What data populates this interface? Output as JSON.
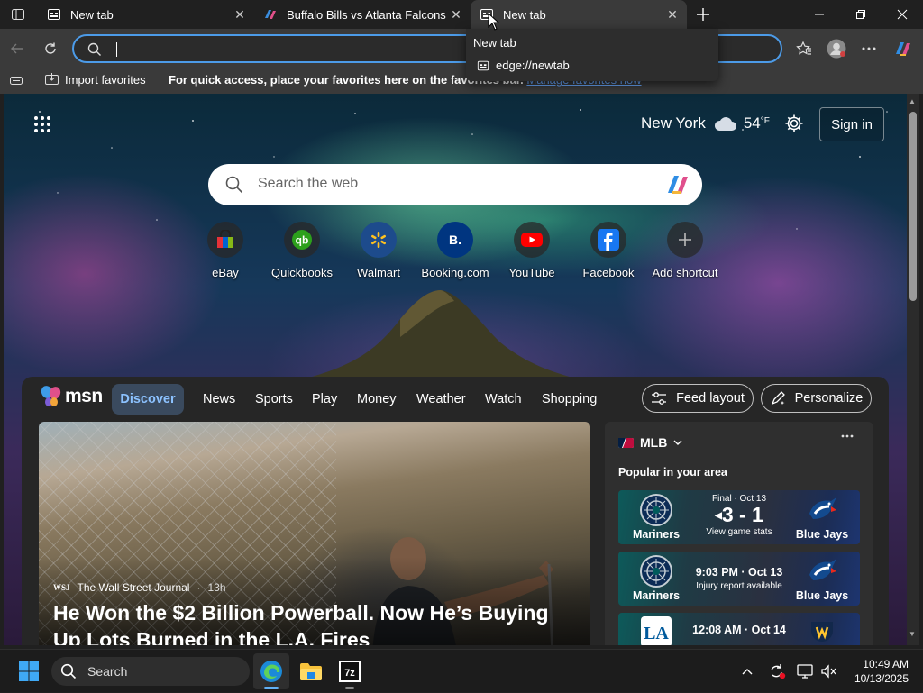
{
  "tabs": [
    {
      "title": "New tab",
      "favicon": "newtab-icon"
    },
    {
      "title": "Buffalo Bills vs Atlanta Falcons - G",
      "favicon": "copilot-icon"
    },
    {
      "title": "New tab",
      "favicon": "newtab-icon",
      "active": true
    }
  ],
  "tab_popup": {
    "title": "New tab",
    "url": "edge://newtab"
  },
  "address_bar": {
    "value": ""
  },
  "favorites_bar": {
    "import_label": "Import favorites",
    "hint": "For quick access, place your favorites here on the favorites bar.",
    "manage_link": "Manage favorites now"
  },
  "newtab": {
    "weather": {
      "city": "New York",
      "temp": "54",
      "unit": "°F",
      "icon": "cloud-icon"
    },
    "signin_label": "Sign in",
    "search_placeholder": "Search the web",
    "quick_links": [
      {
        "name": "eBay",
        "icon": "ebay-icon"
      },
      {
        "name": "Quickbooks",
        "icon": "quickbooks-icon"
      },
      {
        "name": "Walmart",
        "icon": "walmart-icon"
      },
      {
        "name": "Booking.com",
        "icon": "booking-icon"
      },
      {
        "name": "YouTube",
        "icon": "youtube-icon"
      },
      {
        "name": "Facebook",
        "icon": "facebook-icon"
      },
      {
        "name": "Add shortcut",
        "icon": "plus-icon"
      }
    ]
  },
  "feed": {
    "brand": "msn",
    "nav": [
      "Discover",
      "News",
      "Sports",
      "Play",
      "Money",
      "Weather",
      "Watch",
      "Shopping"
    ],
    "feed_layout_label": "Feed layout",
    "personalize_label": "Personalize",
    "hero": {
      "source": "The Wall Street Journal",
      "source_badge": "WSJ",
      "age": "13h",
      "headline": "He Won the $2 Billion Powerball. Now He’s Buying Up Lots Burned in the L.A. Fires"
    },
    "sports_card": {
      "league": "MLB",
      "subtitle": "Popular in your area",
      "games": [
        {
          "home": "Mariners",
          "away": "Blue Jays",
          "status": "Final · Oct 13",
          "score": "3 - 1",
          "note": "View game stats",
          "home_color": "#0c2c56",
          "away_color": "#134a8e"
        },
        {
          "home": "Mariners",
          "away": "Blue Jays",
          "status": "9:03 PM · Oct 13",
          "note": "Injury report available",
          "home_color": "#0c2c56",
          "away_color": "#134a8e"
        },
        {
          "home": "Dodgers",
          "away": "Brewers",
          "status": "12:08 AM · Oct 14",
          "home_color": "#005a9c",
          "away_color": "#12284b"
        }
      ]
    }
  },
  "taskbar": {
    "search_label": "Search",
    "time": "10:49 AM",
    "date": "10/13/2025"
  },
  "colors": {
    "accent": "#4c9be8",
    "discover_bg": "#3a4a5e",
    "discover_text": "#8cc2ff"
  }
}
